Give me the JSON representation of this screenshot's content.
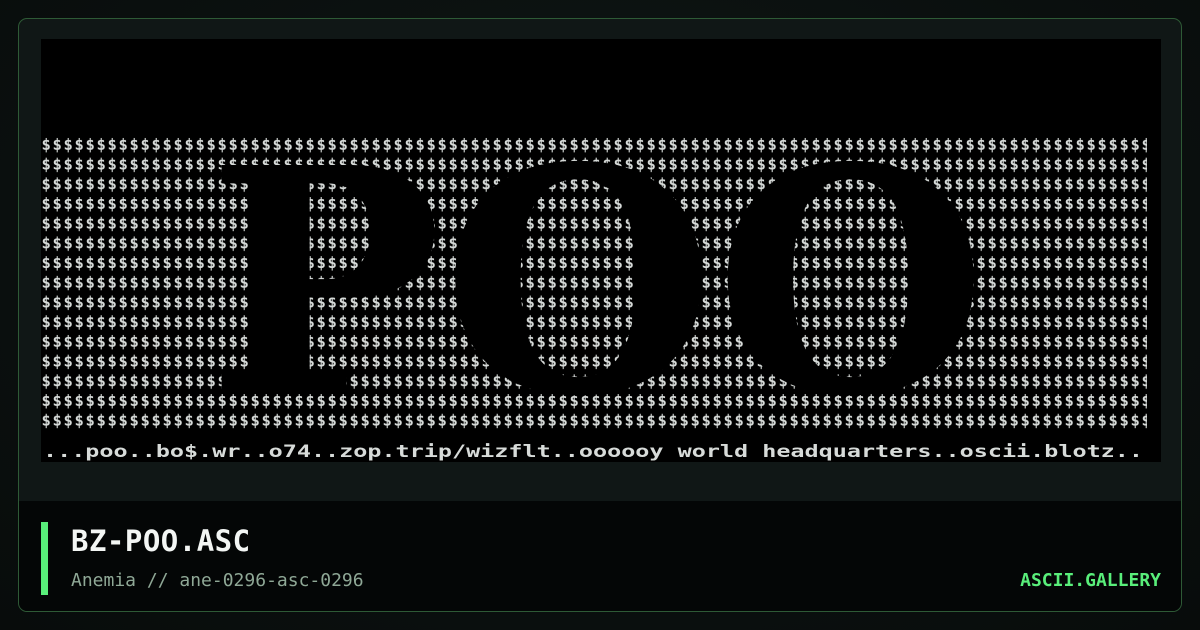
{
  "artwork": {
    "fill_character": "$",
    "big_text": "POO",
    "caption_line": "...poo..bo$.wr..o74..zop.trip/wizflt..oooooy world headquarters..oscii.blotz..",
    "colors": {
      "panel_background": "#000000",
      "ascii_text": "#d7dbd9",
      "big_text": "#000000"
    }
  },
  "card": {
    "title": "BZ-POO.ASC",
    "subtitle": "Anemia // ane-0296-asc-0296",
    "brand": "ASCII.GALLERY",
    "colors": {
      "accent": "#59ee7a",
      "border": "#2e5a36",
      "title": "#f3f6f4",
      "subtitle": "#8fa896"
    }
  }
}
